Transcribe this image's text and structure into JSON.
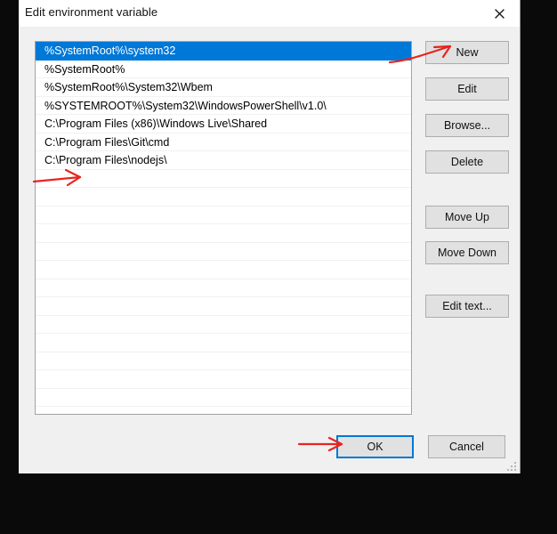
{
  "window": {
    "title": "Edit environment variable",
    "close_icon": "close-icon",
    "accent_color": "#0078d7"
  },
  "list": {
    "items": [
      "%SystemRoot%\\system32",
      "%SystemRoot%",
      "%SystemRoot%\\System32\\Wbem",
      "%SYSTEMROOT%\\System32\\WindowsPowerShell\\v1.0\\",
      "C:\\Program Files (x86)\\Windows Live\\Shared",
      "C:\\Program Files\\Git\\cmd",
      "C:\\Program Files\\nodejs\\"
    ],
    "selected_index": 0,
    "empty_row_count": 13,
    "selection_bg": "#0078d7",
    "selection_fg": "#ffffff"
  },
  "side_buttons": {
    "new": "New",
    "edit": "Edit",
    "browse": "Browse...",
    "delete": "Delete",
    "move_up": "Move Up",
    "move_down": "Move Down",
    "edit_text": "Edit text..."
  },
  "footer_buttons": {
    "ok": "OK",
    "cancel": "Cancel"
  },
  "annotations": {
    "color": "#e8241f",
    "arrows": [
      {
        "name": "arrow-to-new-button",
        "points_to": "New"
      },
      {
        "name": "arrow-to-empty-list-row",
        "points_to": "empty list row"
      },
      {
        "name": "arrow-to-ok-button",
        "points_to": "OK"
      }
    ]
  },
  "resize_grip": "resize-grip-icon"
}
